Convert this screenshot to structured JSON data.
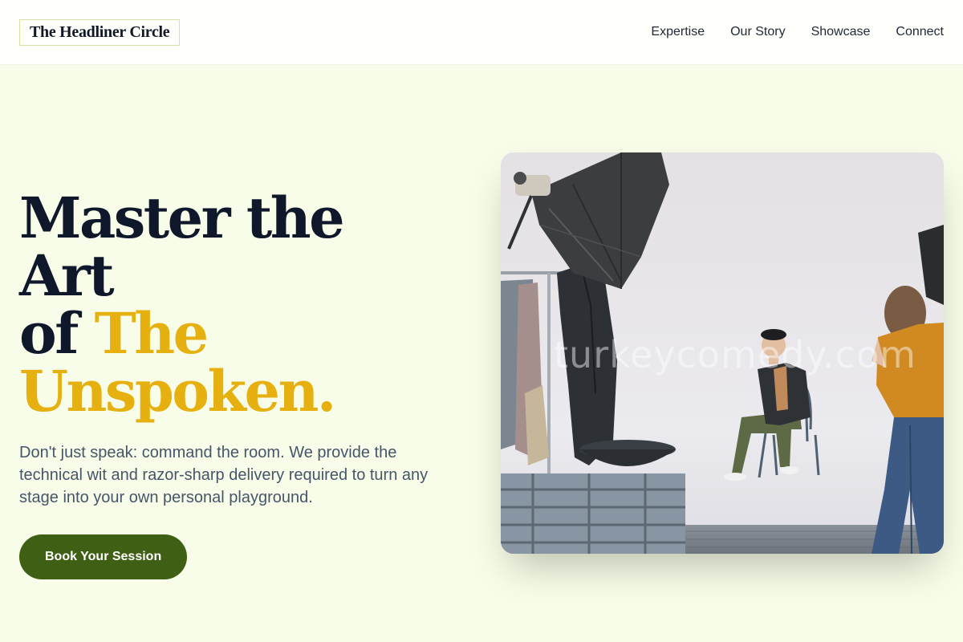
{
  "header": {
    "logo": "The Headliner Circle",
    "nav": [
      {
        "label": "Expertise"
      },
      {
        "label": "Our Story"
      },
      {
        "label": "Showcase"
      },
      {
        "label": "Connect"
      }
    ]
  },
  "hero": {
    "headline_line1": "Master the Art",
    "headline_line2_prefix": "of ",
    "headline_accent_line2": "The",
    "headline_accent_line3": "Unspoken.",
    "lead": "Don't just speak: command the room. We provide the technical wit and razor-sharp delivery required to turn any stage into your own personal playground.",
    "cta_label": "Book Your Session",
    "image": {
      "alt": "Photo studio scene: a man in a hat seated on a chair while a photographer shoots him beside a large softbox and a clothing rack",
      "watermark": "turkeycomedy.com"
    }
  },
  "colors": {
    "background": "#f7fde8",
    "header_background": "#fefefb",
    "headline": "#0f172a",
    "accent": "#e6b110",
    "lead_text": "#475569",
    "cta_background": "#3f5f14",
    "cta_text": "#ffffff"
  }
}
